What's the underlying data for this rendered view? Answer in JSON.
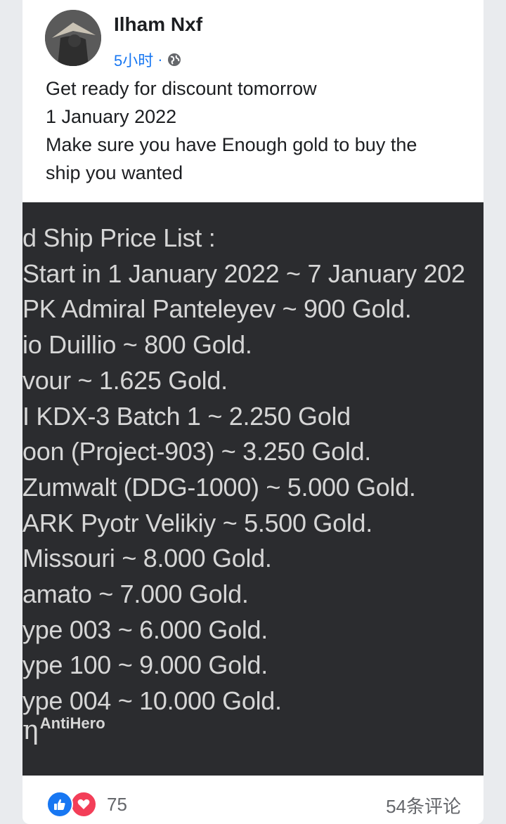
{
  "post": {
    "author": "Ilham Nxf",
    "time": "5小时",
    "separator": "·",
    "visibility_icon": "globe-icon",
    "text_lines": [
      "Get ready for discount tomorrow",
      "1 January 2022",
      "Make sure you have Enough gold to buy the",
      "ship you wanted"
    ]
  },
  "image": {
    "lines": [
      "d Ship Price List :",
      "Start in 1 January 2022 ~ 7 January 202",
      "PK Admiral Panteleyev ~ 900 Gold.",
      "io Duillio ~ 800 Gold.",
      "vour ~ 1.625 Gold.",
      "I KDX-3 Batch 1 ~ 2.250 Gold",
      "oon (Project-903) ~ 3.250 Gold.",
      "Zumwalt (DDG-1000) ~ 5.000 Gold.",
      "ARK Pyotr Velikiy ~ 5.500 Gold.",
      "Missouri ~ 8.000 Gold.",
      "amato ~ 7.000 Gold.",
      "ype 003 ~ 6.000 Gold.",
      "ype 100 ~ 9.000 Gold.",
      "ype 004 ~ 10.000 Gold."
    ],
    "signature_mark": "η",
    "signature_text": "AntiHero"
  },
  "footer": {
    "reaction_icons": [
      "like-icon",
      "love-icon"
    ],
    "reaction_count": "75",
    "comments_label": "54条评论"
  },
  "colors": {
    "link_blue": "#1877f2",
    "like_blue": "#1877f2",
    "love_red": "#f33e58",
    "image_bg": "#2b2c2f",
    "image_text": "#d6d6d6"
  }
}
